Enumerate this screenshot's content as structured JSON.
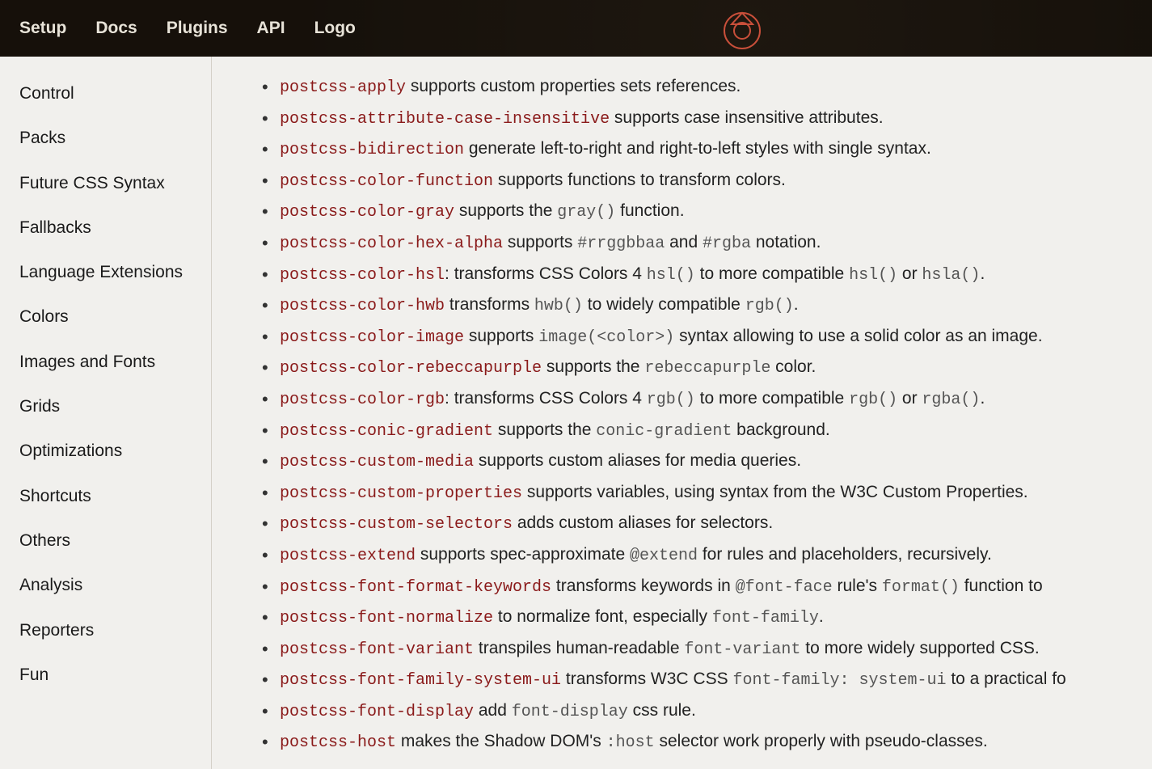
{
  "nav": {
    "items": [
      "Setup",
      "Docs",
      "Plugins",
      "API",
      "Logo"
    ]
  },
  "sidebar": {
    "items": [
      "Control",
      "Packs",
      "Future CSS Syntax",
      "Fallbacks",
      "Language Extensions",
      "Colors",
      "Images and Fonts",
      "Grids",
      "Optimizations",
      "Shortcuts",
      "Others",
      "Analysis",
      "Reporters",
      "Fun"
    ]
  },
  "plugins": [
    {
      "name": "postcss-apply",
      "segments": [
        {
          "t": "text",
          "v": " supports custom properties sets references."
        }
      ]
    },
    {
      "name": "postcss-attribute-case-insensitive",
      "segments": [
        {
          "t": "text",
          "v": " supports case insensitive attributes."
        }
      ]
    },
    {
      "name": "postcss-bidirection",
      "segments": [
        {
          "t": "text",
          "v": " generate left-to-right and right-to-left styles with single syntax."
        }
      ]
    },
    {
      "name": "postcss-color-function",
      "segments": [
        {
          "t": "text",
          "v": " supports functions to transform colors."
        }
      ]
    },
    {
      "name": "postcss-color-gray",
      "segments": [
        {
          "t": "text",
          "v": " supports the "
        },
        {
          "t": "code",
          "v": "gray()"
        },
        {
          "t": "text",
          "v": " function."
        }
      ]
    },
    {
      "name": "postcss-color-hex-alpha",
      "segments": [
        {
          "t": "text",
          "v": " supports "
        },
        {
          "t": "code",
          "v": "#rrggbbaa"
        },
        {
          "t": "text",
          "v": " and "
        },
        {
          "t": "code",
          "v": "#rgba"
        },
        {
          "t": "text",
          "v": " notation."
        }
      ]
    },
    {
      "name": "postcss-color-hsl",
      "segments": [
        {
          "t": "text",
          "v": ": transforms CSS Colors 4 "
        },
        {
          "t": "code",
          "v": "hsl()"
        },
        {
          "t": "text",
          "v": " to more compatible "
        },
        {
          "t": "code",
          "v": "hsl()"
        },
        {
          "t": "text",
          "v": " or "
        },
        {
          "t": "code",
          "v": "hsla()"
        },
        {
          "t": "text",
          "v": "."
        }
      ]
    },
    {
      "name": "postcss-color-hwb",
      "segments": [
        {
          "t": "text",
          "v": " transforms "
        },
        {
          "t": "code",
          "v": "hwb()"
        },
        {
          "t": "text",
          "v": " to widely compatible "
        },
        {
          "t": "code",
          "v": "rgb()"
        },
        {
          "t": "text",
          "v": "."
        }
      ]
    },
    {
      "name": "postcss-color-image",
      "segments": [
        {
          "t": "text",
          "v": " supports "
        },
        {
          "t": "code",
          "v": "image(<color>)"
        },
        {
          "t": "text",
          "v": " syntax allowing to use a solid color as an image."
        }
      ]
    },
    {
      "name": "postcss-color-rebeccapurple",
      "segments": [
        {
          "t": "text",
          "v": " supports the "
        },
        {
          "t": "code",
          "v": "rebeccapurple"
        },
        {
          "t": "text",
          "v": " color."
        }
      ]
    },
    {
      "name": "postcss-color-rgb",
      "segments": [
        {
          "t": "text",
          "v": ": transforms CSS Colors 4 "
        },
        {
          "t": "code",
          "v": "rgb()"
        },
        {
          "t": "text",
          "v": " to more compatible "
        },
        {
          "t": "code",
          "v": "rgb()"
        },
        {
          "t": "text",
          "v": " or "
        },
        {
          "t": "code",
          "v": "rgba()"
        },
        {
          "t": "text",
          "v": "."
        }
      ]
    },
    {
      "name": "postcss-conic-gradient",
      "segments": [
        {
          "t": "text",
          "v": " supports the "
        },
        {
          "t": "code",
          "v": "conic-gradient"
        },
        {
          "t": "text",
          "v": " background."
        }
      ]
    },
    {
      "name": "postcss-custom-media",
      "segments": [
        {
          "t": "text",
          "v": " supports custom aliases for media queries."
        }
      ]
    },
    {
      "name": "postcss-custom-properties",
      "segments": [
        {
          "t": "text",
          "v": " supports variables, using syntax from the W3C Custom Properties."
        }
      ]
    },
    {
      "name": "postcss-custom-selectors",
      "segments": [
        {
          "t": "text",
          "v": " adds custom aliases for selectors."
        }
      ]
    },
    {
      "name": "postcss-extend",
      "segments": [
        {
          "t": "text",
          "v": " supports spec-approximate "
        },
        {
          "t": "code",
          "v": "@extend"
        },
        {
          "t": "text",
          "v": " for rules and placeholders, recursively."
        }
      ]
    },
    {
      "name": "postcss-font-format-keywords",
      "segments": [
        {
          "t": "text",
          "v": " transforms keywords in "
        },
        {
          "t": "code",
          "v": "@font-face"
        },
        {
          "t": "text",
          "v": " rule's "
        },
        {
          "t": "code",
          "v": "format()"
        },
        {
          "t": "text",
          "v": " function to"
        }
      ]
    },
    {
      "name": "postcss-font-normalize",
      "segments": [
        {
          "t": "text",
          "v": " to normalize font, especially "
        },
        {
          "t": "code",
          "v": "font-family"
        },
        {
          "t": "text",
          "v": "."
        }
      ]
    },
    {
      "name": "postcss-font-variant",
      "segments": [
        {
          "t": "text",
          "v": " transpiles human-readable "
        },
        {
          "t": "code",
          "v": "font-variant"
        },
        {
          "t": "text",
          "v": " to more widely supported CSS."
        }
      ]
    },
    {
      "name": "postcss-font-family-system-ui",
      "segments": [
        {
          "t": "text",
          "v": " transforms W3C CSS "
        },
        {
          "t": "code",
          "v": "font-family: system-ui"
        },
        {
          "t": "text",
          "v": " to a practical fo"
        }
      ]
    },
    {
      "name": "postcss-font-display",
      "segments": [
        {
          "t": "text",
          "v": " add "
        },
        {
          "t": "code",
          "v": "font-display"
        },
        {
          "t": "text",
          "v": " css rule."
        }
      ]
    },
    {
      "name": "postcss-host",
      "segments": [
        {
          "t": "text",
          "v": " makes the Shadow DOM's "
        },
        {
          "t": "code",
          "v": ":host"
        },
        {
          "t": "text",
          "v": " selector work properly with pseudo-classes."
        }
      ]
    }
  ]
}
